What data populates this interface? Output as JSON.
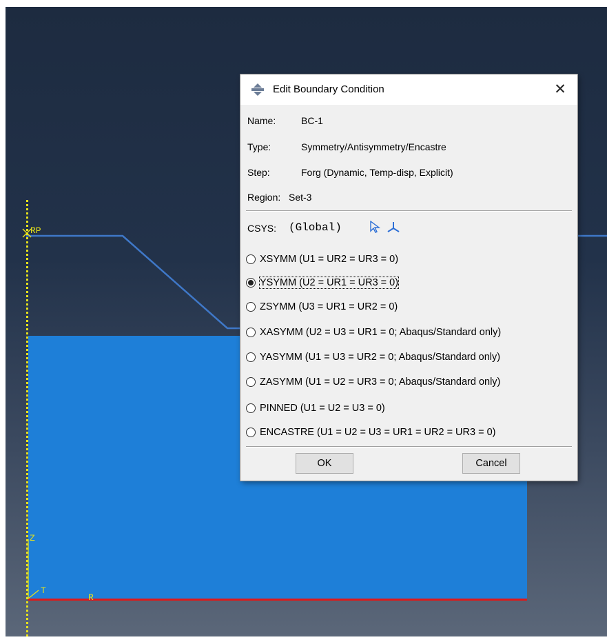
{
  "viewport": {
    "labels": {
      "rp": "RP",
      "z_axis": "Z",
      "t_axis": "T",
      "r_axis": "R"
    },
    "colors": {
      "part_fill": "#1e7fd8",
      "boundary_edge": "#e01818",
      "axis_yellow": "#e7e21a"
    }
  },
  "dialog": {
    "title": "Edit Boundary Condition",
    "close_symbol": "✕",
    "info": {
      "name_label": "Name:",
      "name_value": "BC-1",
      "type_label": "Type:",
      "type_value": "Symmetry/Antisymmetry/Encastre",
      "step_label": "Step:",
      "step_value": "Forg (Dynamic, Temp-disp, Explicit)",
      "region_label": "Region:",
      "region_value": "Set-3"
    },
    "csys": {
      "label": "CSYS:",
      "value": "(Global)",
      "icons": [
        "select-arrow-icon",
        "csys-axes-icon"
      ]
    },
    "options": [
      {
        "label": "XSYMM (U1 = UR2 = UR3 = 0)",
        "selected": false
      },
      {
        "label": "YSYMM (U2 = UR1 = UR3 = 0)",
        "selected": true
      },
      {
        "label": "ZSYMM (U3 = UR1 = UR2 = 0)",
        "selected": false
      },
      {
        "label": "XASYMM (U2 = U3 = UR1 = 0; Abaqus/Standard only)",
        "selected": false
      },
      {
        "label": "YASYMM (U1 = U3 = UR2 = 0; Abaqus/Standard only)",
        "selected": false
      },
      {
        "label": "ZASYMM (U1 = U2 = UR3 = 0; Abaqus/Standard only)",
        "selected": false
      },
      {
        "label": "PINNED (U1 = U2 = U3 = 0)",
        "selected": false
      },
      {
        "label": "ENCASTRE (U1 = U2 = U3 = UR1 = UR2 = UR3 = 0)",
        "selected": false
      }
    ],
    "buttons": {
      "ok": "OK",
      "cancel": "Cancel"
    }
  }
}
